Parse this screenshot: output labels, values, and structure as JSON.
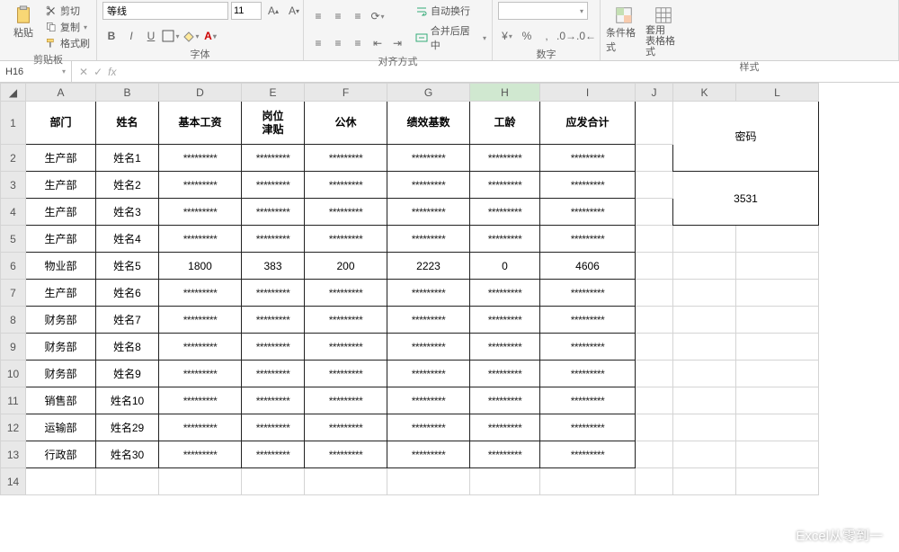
{
  "ribbon": {
    "clipboard": {
      "paste": "粘贴",
      "cut": "剪切",
      "copy": "复制",
      "fmtpaint": "格式刷",
      "label": "剪贴板"
    },
    "font": {
      "name": "等线",
      "size": "11",
      "label": "字体",
      "bold": "B",
      "italic": "I",
      "underline": "U"
    },
    "align": {
      "wrap": "自动换行",
      "merge": "合并后居中",
      "label": "对齐方式"
    },
    "number": {
      "label": "数字"
    },
    "styles": {
      "cond": "条件格式",
      "table": "套用\n表格格式",
      "label": "样式"
    }
  },
  "namebox": "H16",
  "cols": [
    "A",
    "B",
    "D",
    "E",
    "F",
    "G",
    "H",
    "I",
    "J",
    "K",
    "L"
  ],
  "headers": {
    "dept": "部门",
    "name": "姓名",
    "base": "基本工资",
    "allow": "岗位\n津贴",
    "leave": "公休",
    "perf": "绩效基数",
    "seniority": "工龄",
    "total": "应发合计"
  },
  "password": {
    "label": "密码",
    "value": "3531"
  },
  "mask": "*********",
  "rows": [
    {
      "r": "2",
      "dept": "生产部",
      "name": "姓名1",
      "vals": [
        "*",
        "*",
        "*",
        "*",
        "*",
        "*"
      ]
    },
    {
      "r": "3",
      "dept": "生产部",
      "name": "姓名2",
      "vals": [
        "*",
        "*",
        "*",
        "*",
        "*",
        "*"
      ]
    },
    {
      "r": "4",
      "dept": "生产部",
      "name": "姓名3",
      "vals": [
        "*",
        "*",
        "*",
        "*",
        "*",
        "*"
      ]
    },
    {
      "r": "5",
      "dept": "生产部",
      "name": "姓名4",
      "vals": [
        "*",
        "*",
        "*",
        "*",
        "*",
        "*"
      ]
    },
    {
      "r": "6",
      "dept": "物业部",
      "name": "姓名5",
      "vals": [
        "1800",
        "383",
        "200",
        "2223",
        "0",
        "4606"
      ]
    },
    {
      "r": "7",
      "dept": "生产部",
      "name": "姓名6",
      "vals": [
        "*",
        "*",
        "*",
        "*",
        "*",
        "*"
      ]
    },
    {
      "r": "8",
      "dept": "财务部",
      "name": "姓名7",
      "vals": [
        "*",
        "*",
        "*",
        "*",
        "*",
        "*"
      ]
    },
    {
      "r": "9",
      "dept": "财务部",
      "name": "姓名8",
      "vals": [
        "*",
        "*",
        "*",
        "*",
        "*",
        "*"
      ]
    },
    {
      "r": "10",
      "dept": "财务部",
      "name": "姓名9",
      "vals": [
        "*",
        "*",
        "*",
        "*",
        "*",
        "*"
      ]
    },
    {
      "r": "11",
      "dept": "销售部",
      "name": "姓名10",
      "vals": [
        "*",
        "*",
        "*",
        "*",
        "*",
        "*"
      ]
    },
    {
      "r": "12",
      "dept": "运输部",
      "name": "姓名29",
      "vals": [
        "*",
        "*",
        "*",
        "*",
        "*",
        "*"
      ]
    },
    {
      "r": "13",
      "dept": "行政部",
      "name": "姓名30",
      "vals": [
        "*",
        "*",
        "*",
        "*",
        "*",
        "*"
      ]
    }
  ],
  "watermark": "Excel从零到一"
}
